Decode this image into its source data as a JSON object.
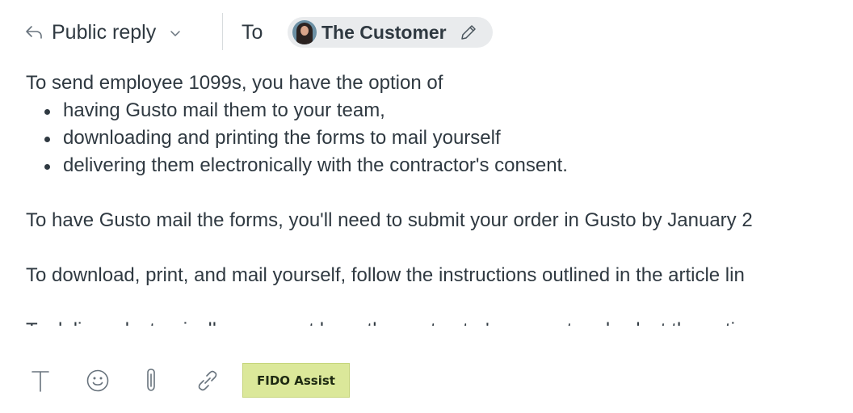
{
  "header": {
    "reply_type": "Public reply",
    "to_label": "To",
    "recipient": "The Customer",
    "icons": {
      "reply": "reply-arrow-icon",
      "dropdown": "chevron-down-icon",
      "avatar": "customer-avatar",
      "edit": "pencil-icon"
    }
  },
  "body": {
    "intro": "To send employee 1099s, you have the option of",
    "bullets": [
      "having Gusto mail them to your team,",
      "downloading and printing the forms to mail yourself",
      "delivering them electronically with the contractor's consent."
    ],
    "paragraphs": [
      "To have Gusto mail the forms, you'll need to submit your order in Gusto by January 2",
      "To download, print, and mail yourself, follow the instructions outlined in the article lin",
      "To deliver electronically, you must have the contractor's consent and select the optic"
    ]
  },
  "toolbar": {
    "icons": [
      "text-format-icon",
      "emoji-icon",
      "attachment-icon",
      "link-icon"
    ],
    "fido_label": "FIDO Assist",
    "fido_color": "#dbe89a"
  }
}
